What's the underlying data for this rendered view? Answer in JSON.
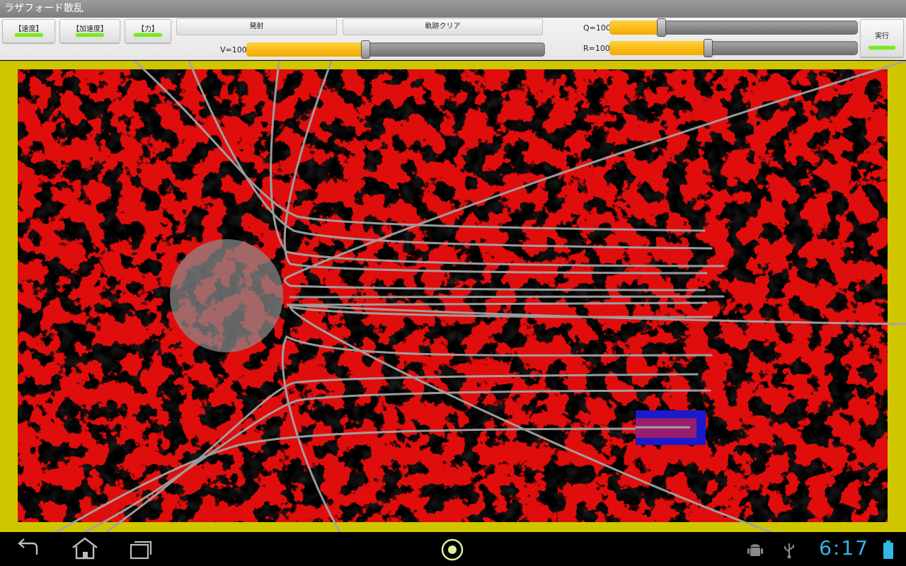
{
  "app": {
    "title": "ラザフォード散乱"
  },
  "toolbar": {
    "toggle_velocity": "【速度】",
    "toggle_acceleration": "【加速度】",
    "toggle_force": "【力】",
    "fire_label": "発射",
    "clear_label": "軌跡クリア",
    "run_label": "実行",
    "indicator_color": "#7be52a"
  },
  "sliders": {
    "v": {
      "label": "V=100",
      "fraction": 0.4
    },
    "q": {
      "label": "Q=100",
      "fraction": 0.21
    },
    "r": {
      "label": "R=100",
      "fraction": 0.4
    }
  },
  "status": {
    "time": "6:17"
  },
  "colors": {
    "frame": "#cfc600",
    "trail": "#a0a0a0",
    "nucleus": "#8a8a8a",
    "emitter": "#1a1acc",
    "accent": "#f4b400",
    "clock": "#33b5e5"
  },
  "icons": {
    "back": "back-icon",
    "home": "home-icon",
    "recent": "recent-apps-icon",
    "center": "app-center-icon",
    "android": "android-debug-icon",
    "usb": "usb-icon",
    "battery": "battery-icon"
  }
}
